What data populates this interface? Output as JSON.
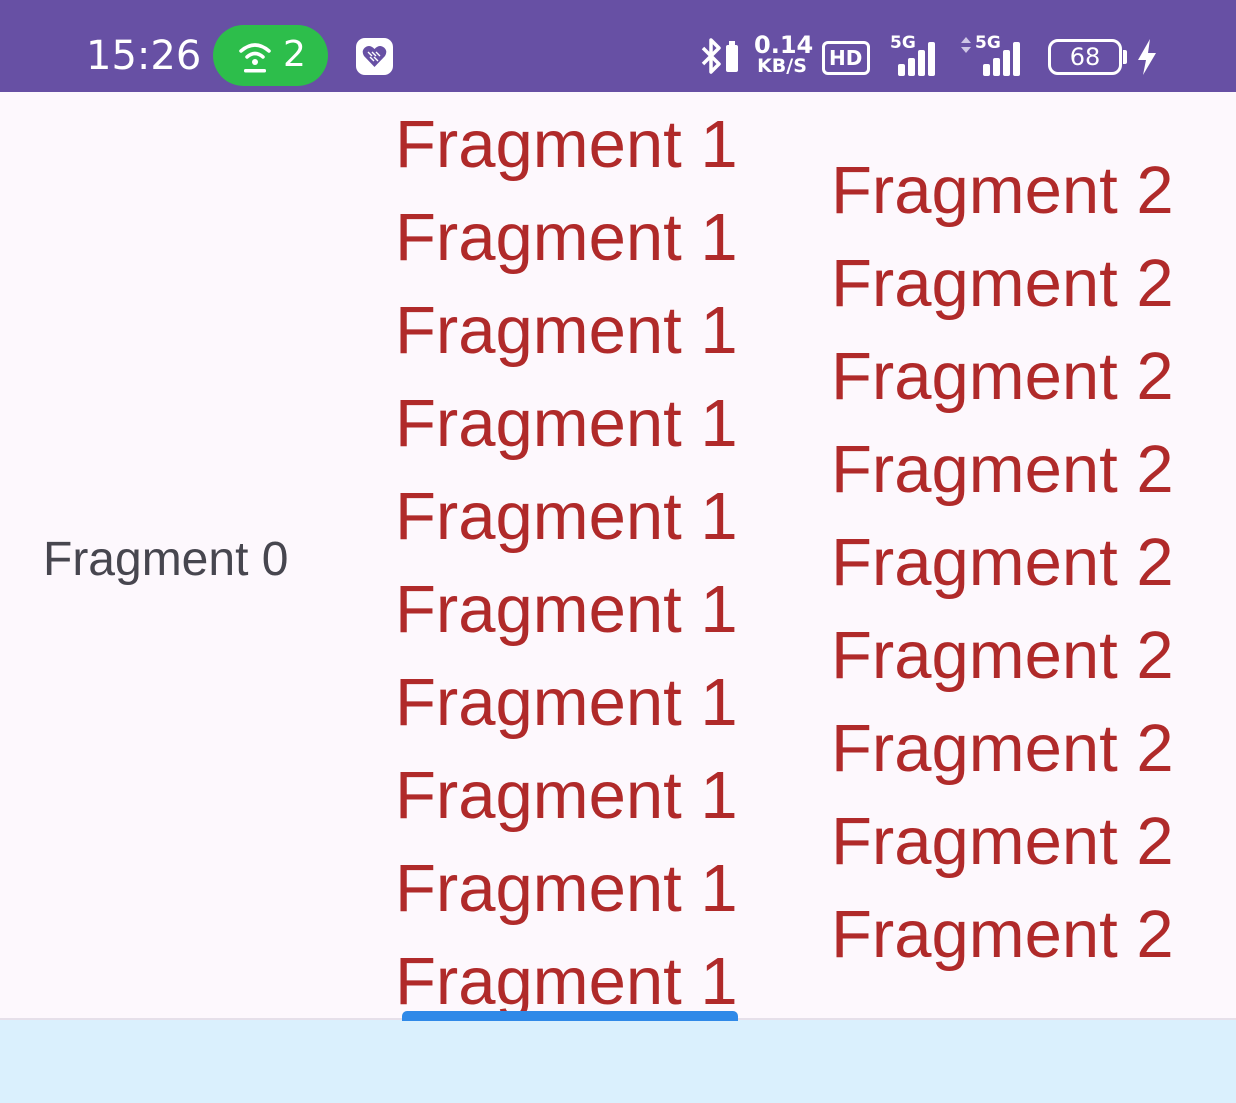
{
  "status_bar": {
    "time": "15:26",
    "hotspot_count": "2",
    "net_speed_value": "0.14",
    "net_speed_unit": "KB/S",
    "hd_label": "HD",
    "signal1_label": "5G",
    "signal2_label": "5G",
    "battery_level": "68"
  },
  "fragments": {
    "fragment0": "Fragment 0",
    "column1": [
      "Fragment 1",
      "Fragment 1",
      "Fragment 1",
      "Fragment 1",
      "Fragment 1",
      "Fragment 1",
      "Fragment 1",
      "Fragment 1",
      "Fragment 1",
      "Fragment 1"
    ],
    "column2": [
      "Fragment 2",
      "Fragment 2",
      "Fragment 2",
      "Fragment 2",
      "Fragment 2",
      "Fragment 2",
      "Fragment 2",
      "Fragment 2",
      "Fragment 2"
    ]
  },
  "colors": {
    "status_bar_bg": "#6750a4",
    "fragment_text_red": "#b02a2a",
    "fragment0_text": "#47464f",
    "indicator": "#2f89e8",
    "bottom_bar_bg": "#daf0fd"
  }
}
